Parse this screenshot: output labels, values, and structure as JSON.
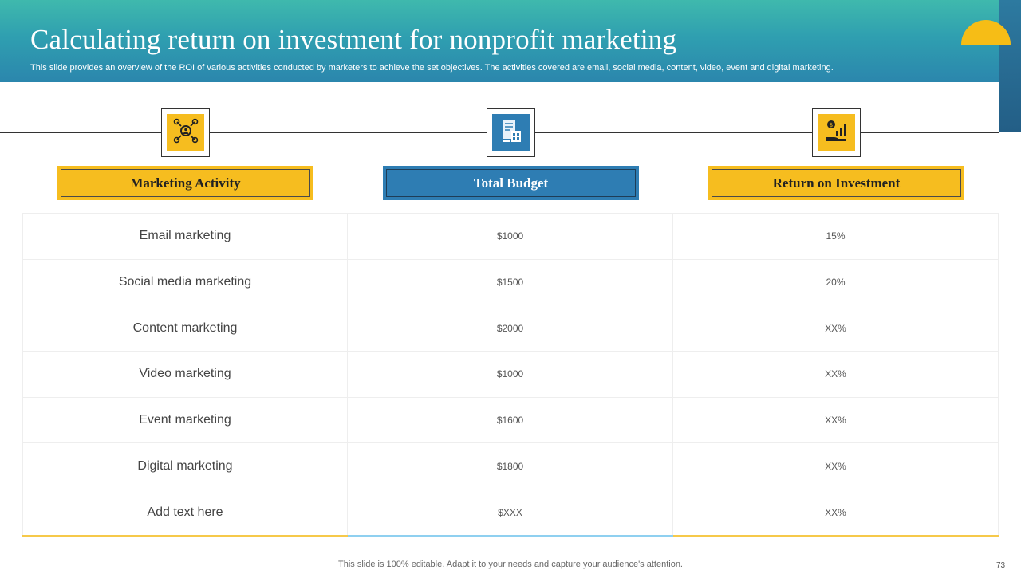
{
  "header": {
    "title": "Calculating return on investment for nonprofit marketing",
    "subtitle": "This slide provides an overview of the ROI of various activities conducted by marketers to achieve the set objectives. The activities covered are email, social media, content, video, event and digital marketing."
  },
  "columns": [
    {
      "label": "Marketing Activity",
      "icon": "network-people-icon",
      "color": "#f6bd1f"
    },
    {
      "label": "Total Budget",
      "icon": "budget-document-icon",
      "color": "#2e7db3"
    },
    {
      "label": "Return on Investment",
      "icon": "hand-money-growth-icon",
      "color": "#f6bd1f"
    }
  ],
  "rows": [
    {
      "activity": "Email marketing",
      "budget": "$1000",
      "roi": "15%"
    },
    {
      "activity": "Social media marketing",
      "budget": "$1500",
      "roi": "20%"
    },
    {
      "activity": "Content marketing",
      "budget": "$2000",
      "roi": "XX%"
    },
    {
      "activity": "Video marketing",
      "budget": "$1000",
      "roi": "XX%"
    },
    {
      "activity": "Event marketing",
      "budget": "$1600",
      "roi": "XX%"
    },
    {
      "activity": "Digital marketing",
      "budget": "$1800",
      "roi": "XX%"
    },
    {
      "activity": "Add text here",
      "budget": "$XXX",
      "roi": "XX%"
    }
  ],
  "footer": {
    "note": "This slide is 100% editable. Adapt it to your needs and capture your audience's attention.",
    "page_number": "73"
  },
  "colors": {
    "accent_yellow": "#f6bd1f",
    "accent_blue": "#2e7db3",
    "header_teal": "#3fb9ad",
    "bottom_line_blue": "#8fd0f0"
  }
}
